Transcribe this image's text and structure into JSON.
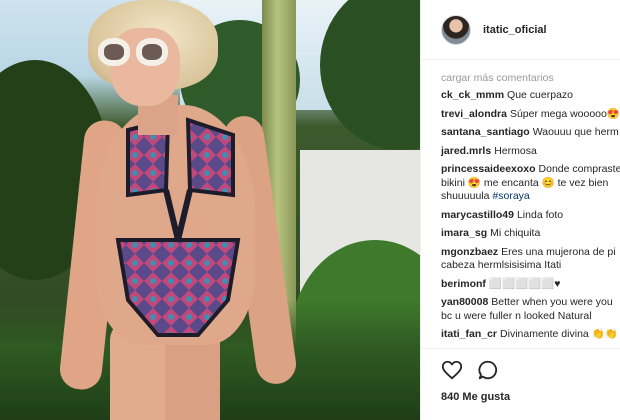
{
  "post": {
    "username": "itatic_oficial",
    "load_more": "cargar más comentarios",
    "comments": [
      {
        "user": "ck_ck_mmm",
        "text": "Que cuerpazo"
      },
      {
        "user": "trevi_alondra",
        "text": "Súper mega wooooo😍"
      },
      {
        "user": "santana_santiago",
        "text": "Waouuu que herm"
      },
      {
        "user": "jared.mrls",
        "text": "Hermosa"
      },
      {
        "user": "princessaideexoxo",
        "text": "Donde compraste",
        "line2": "bikini 😍 me encanta 😊 te vez bien",
        "line3": "shuuuuula ",
        "tag": "#soraya"
      },
      {
        "user": "marycastillo49",
        "text": "Linda foto"
      },
      {
        "user": "imara_sg",
        "text": "Mi chiquita"
      },
      {
        "user": "mgonzbaez",
        "text": "Eres una mujerona de pi",
        "line2": "cabeza hermlsisisima Itati"
      },
      {
        "user": "berimonf",
        "text": "⬜⬜⬜⬜⬜♥"
      },
      {
        "user": "yan80008",
        "text": "Better when you were you",
        "line2": "bc u were fuller n looked Natural"
      },
      {
        "user": "itati_fan_cr",
        "text": "Divinamente divina 👏👏"
      }
    ],
    "likes": "840 Me gusta",
    "icons": {
      "like": "heart-icon",
      "comment": "comment-bubble-icon"
    }
  }
}
